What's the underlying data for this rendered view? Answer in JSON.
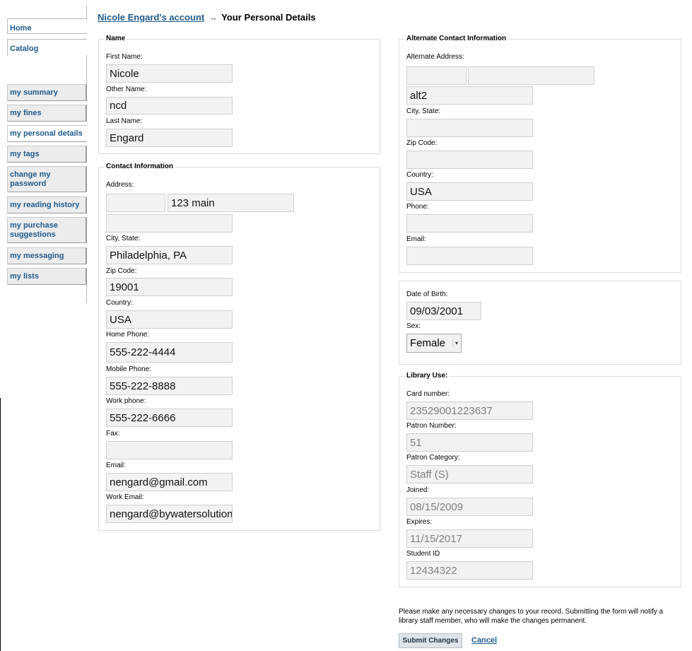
{
  "nav": {
    "home": "Home",
    "catalog": "Catalog"
  },
  "menu": {
    "items": [
      {
        "label": "my summary"
      },
      {
        "label": "my fines"
      },
      {
        "label": "my personal details"
      },
      {
        "label": "my tags"
      },
      {
        "label": "change my password"
      },
      {
        "label": "my reading history"
      },
      {
        "label": "my purchase suggestions"
      },
      {
        "label": "my messaging"
      },
      {
        "label": "my lists"
      }
    ]
  },
  "breadcrumb": {
    "account_link": "Nicole Engard's account",
    "arrow": "→",
    "current": "Your Personal Details"
  },
  "name_section": {
    "legend": "Name",
    "first_name_label": "First Name:",
    "first_name": "Nicole",
    "other_name_label": "Other Name:",
    "other_name": "ncd",
    "last_name_label": "Last Name:",
    "last_name": "Engard"
  },
  "contact": {
    "legend": "Contact Information",
    "address_label": "Address:",
    "street_number": "",
    "address": "123 main",
    "address2": "",
    "city_label": "City, State:",
    "city": "Philadelphia, PA",
    "zip_label": "Zip Code:",
    "zip": "19001",
    "country_label": "Country:",
    "country": "USA",
    "home_phone_label": "Home Phone:",
    "home_phone": "555-222-4444",
    "mobile_phone_label": "Mobile Phone:",
    "mobile_phone": "555-222-8888",
    "work_phone_label": "Work phone:",
    "work_phone": "555-222-6666",
    "fax_label": "Fax:",
    "fax": "",
    "email_label": "Email:",
    "email": "nengard@gmail.com",
    "work_email_label": "Work Email:",
    "work_email": "nengard@bywatersolutions"
  },
  "alternate": {
    "legend": "Alternate Contact Information",
    "address_label": "Alternate Address:",
    "street_number": "",
    "address": "",
    "address2": "alt2",
    "city_label": "City, State:",
    "city": "",
    "zip_label": "Zip Code:",
    "zip": "",
    "country_label": "Country:",
    "country": "USA",
    "phone_label": "Phone:",
    "phone": "",
    "email_label": "Email:",
    "email": ""
  },
  "personal": {
    "dob_label": "Date of Birth:",
    "dob": "09/03/2001",
    "sex_label": "Sex:",
    "sex": "Female"
  },
  "library_use": {
    "legend": "Library Use:",
    "card_label": "Card number:",
    "card": "23529001223637",
    "patron_label": "Patron Number:",
    "patron": "51",
    "category_label": "Patron Category:",
    "category": "Staff (S)",
    "joined_label": "Joined:",
    "joined": "08/15/2009",
    "expires_label": "Expires:",
    "expires": "11/15/2017",
    "student_label": "Student ID",
    "student": "12434322"
  },
  "footer": {
    "note": "Please make any necessary changes to your record. Submitting the form will notify a library staff member, who will make the changes permanent.",
    "submit": "Submit Changes",
    "cancel": "Cancel"
  }
}
